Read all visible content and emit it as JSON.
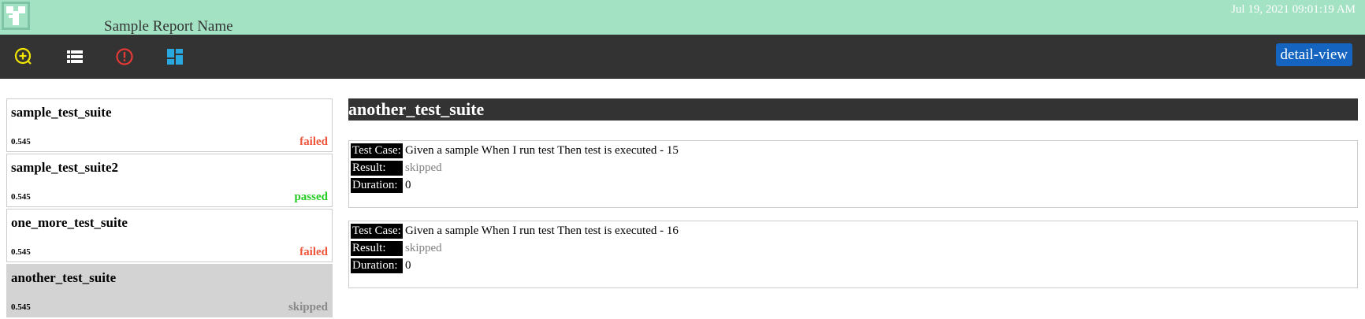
{
  "header": {
    "report_title": "Sample Report Name",
    "timestamp": "Jul 19, 2021 09:01:19 AM",
    "logo_icon": "report-logo-icon"
  },
  "toolbar": {
    "icons": [
      {
        "name": "add-circle-icon",
        "color": "#f2e600"
      },
      {
        "name": "list-icon",
        "color": "#ffffff"
      },
      {
        "name": "error-icon",
        "color": "#e53935"
      },
      {
        "name": "dashboard-icon",
        "color": "#29a8e0"
      }
    ],
    "view_button_label": "detail-view"
  },
  "colors": {
    "header_bg": "#a3e2c2",
    "toolbar_bg": "#333333",
    "failed": "#f0553c",
    "passed": "#22cc22",
    "skipped": "#888888",
    "button_bg": "#1565c0"
  },
  "suites": [
    {
      "name": "sample_test_suite",
      "duration": "0.545",
      "status": "failed"
    },
    {
      "name": "sample_test_suite2",
      "duration": "0.545",
      "status": "passed"
    },
    {
      "name": "one_more_test_suite",
      "duration": "0.545",
      "status": "failed"
    },
    {
      "name": "another_test_suite",
      "duration": "0.545",
      "status": "skipped"
    }
  ],
  "detail": {
    "suite_title": "another_test_suite",
    "labels": {
      "test_case": "Test Case:",
      "result": "Result:",
      "duration": "Duration:"
    },
    "cases": [
      {
        "test_case": "Given a sample When I run test Then test is executed - 15",
        "result": "skipped",
        "duration": "0"
      },
      {
        "test_case": "Given a sample When I run test Then test is executed - 16",
        "result": "skipped",
        "duration": "0"
      }
    ]
  }
}
